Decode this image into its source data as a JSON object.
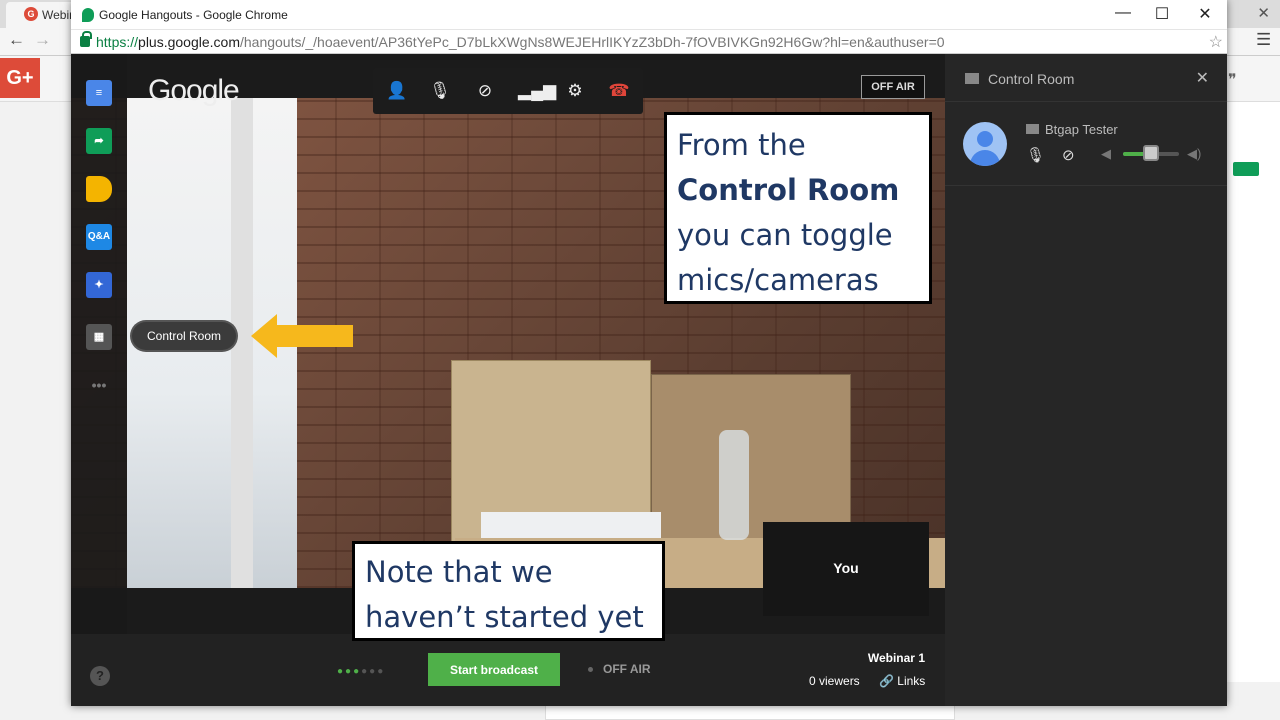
{
  "background": {
    "tab_label": "Webin",
    "gplus_label": "G+"
  },
  "window": {
    "title": "Google Hangouts - Google Chrome",
    "url_scheme": "https://",
    "url_host": "plus.google.com",
    "url_path": "/hangouts/_/hoaevent/AP36tYePc_D7bLkXWgNs8WEJEHrlIKYzZ3bDh-7fOVBIVKGn92H6Gw?hl=en&authuser=0"
  },
  "hangout": {
    "logo": "Google",
    "status_top": "OFF AIR",
    "tooltip": "Control Room",
    "you_label": "You",
    "sidebar_icons": {
      "qa_label": "Q&A",
      "more_label": "•••"
    }
  },
  "bottombar": {
    "start_broadcast": "Start broadcast",
    "status": "OFF AIR",
    "event_name": "Webinar 1",
    "viewers": "0 viewers",
    "links": "Links",
    "help": "?"
  },
  "control_room": {
    "title": "Control Room",
    "participant_name": "Btgap Tester",
    "volume_level": 0.5
  },
  "annotations": {
    "callout1_line1": "From the",
    "callout1_bold": "Control Room",
    "callout1_line3": "you can toggle",
    "callout1_line4": "mics/cameras",
    "callout2_line1": "Note that we",
    "callout2_line2": "haven’t started yet"
  },
  "colors": {
    "accent_green": "#4fb049",
    "annotation_text": "#1f3864",
    "arrow_yellow": "#f6b81c",
    "hangup_red": "#e0453a"
  },
  "icons": [
    "chat-icon",
    "share-icon",
    "tag-icon",
    "qa-icon",
    "toolbox-icon",
    "control-room-icon",
    "add-person-icon",
    "mic-off-icon",
    "camera-off-icon",
    "signal-icon",
    "settings-icon",
    "hangup-icon",
    "close-icon",
    "link-icon",
    "help-icon"
  ]
}
